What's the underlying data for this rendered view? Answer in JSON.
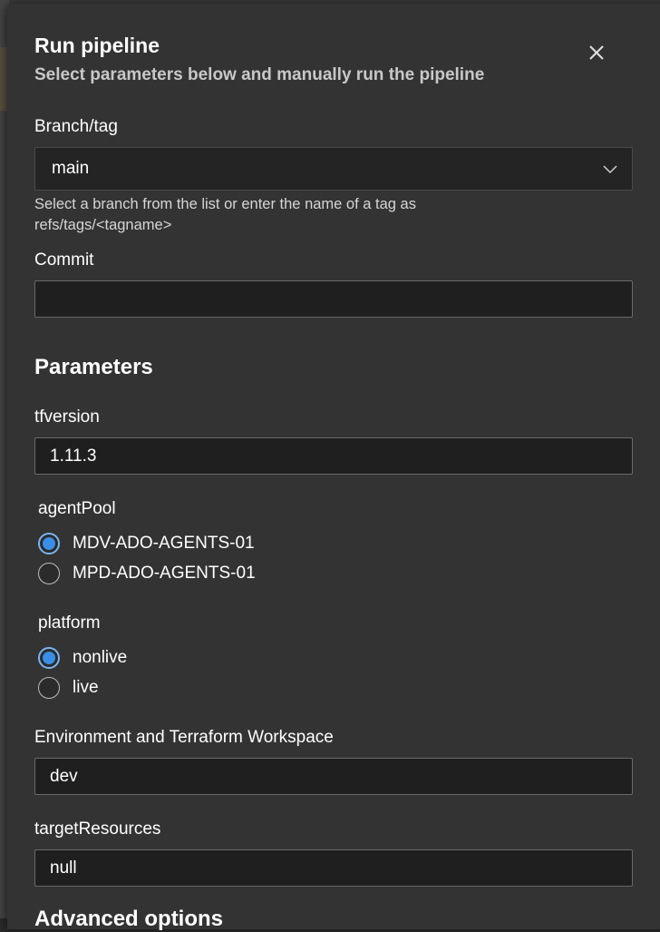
{
  "dialog": {
    "title": "Run pipeline",
    "subtitle": "Select parameters below and manually run the pipeline"
  },
  "branch": {
    "label": "Branch/tag",
    "value": "main",
    "help": "Select a branch from the list or enter the name of a tag as refs/tags/<tagname>"
  },
  "commit": {
    "label": "Commit",
    "value": ""
  },
  "parameters": {
    "title": "Parameters",
    "tfversion": {
      "label": "tfversion",
      "value": "1.11.3"
    },
    "agentPool": {
      "label": "agentPool",
      "options": [
        {
          "label": "MDV-ADO-AGENTS-01",
          "checked": true
        },
        {
          "label": "MPD-ADO-AGENTS-01",
          "checked": false
        }
      ]
    },
    "platform": {
      "label": "platform",
      "options": [
        {
          "label": "nonlive",
          "checked": true
        },
        {
          "label": "live",
          "checked": false
        }
      ]
    },
    "environment": {
      "label": "Environment and Terraform Workspace",
      "value": "dev"
    },
    "targetResources": {
      "label": "targetResources",
      "value": "null"
    }
  },
  "advanced": {
    "title": "Advanced options"
  },
  "colors": {
    "panel": "#333333",
    "input_bg": "#1f1f1f",
    "radio_accent": "#3a8ee6"
  }
}
